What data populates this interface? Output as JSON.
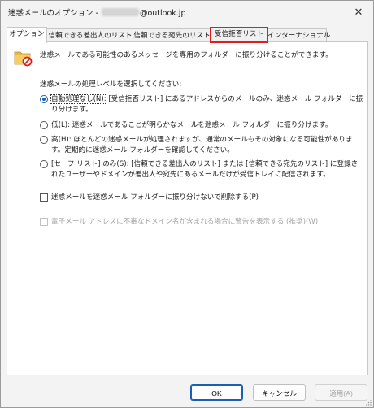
{
  "window": {
    "title_prefix": "迷惑メールのオプション - ",
    "title_suffix": "@outlook.jp",
    "close_glyph": "✕"
  },
  "tabs": [
    {
      "label": "オプション",
      "active": true
    },
    {
      "label": "信頼できる差出人のリスト"
    },
    {
      "label": "信頼できる宛先のリスト"
    },
    {
      "label": "受信拒否リスト",
      "highlighted": true
    },
    {
      "label": "インターナショナル"
    }
  ],
  "options": {
    "intro": "迷惑メールである可能性のあるメッセージを専用のフォルダーに振り分けることができます。",
    "level_label": "迷惑メールの処理レベルを選択してください:",
    "levels": [
      {
        "focus_text": "自動処理なし(N):",
        "text": " [受信拒否リスト] にあるアドレスからのメールのみ、迷惑メール フォルダーに振り分けます。",
        "checked": true
      },
      {
        "text": "低(L): 迷惑メールであることが明らかなメールを迷惑メール フォルダーに振り分けます。"
      },
      {
        "text": "高(H): ほとんどの迷惑メールが処理されますが、通常のメールもその対象になる可能性があります。定期的に迷惑メール フォルダーを確認してください。"
      },
      {
        "text": "[セーフ リスト] のみ(S): [信頼できる差出人のリスト] または [信頼できる宛先のリスト] に登録されたユーザーやドメインが差出人や宛先にあるメールだけが受信トレイに配信されます。"
      }
    ],
    "delete_label": "迷惑メールを迷惑メール フォルダーに振り分けないで削除する(P)",
    "warn_label": "電子メール アドレスに不審なドメイン名が含まれる場合に警告を表示する (推奨)(W)"
  },
  "buttons": {
    "ok": "OK",
    "cancel": "キャンセル",
    "apply": "適用(A)"
  },
  "colors": {
    "accent": "#1a5fb4",
    "highlight_border": "#e01c1c"
  },
  "icons": {
    "junk": "junk-mail-folder-icon",
    "close": "close-icon"
  }
}
